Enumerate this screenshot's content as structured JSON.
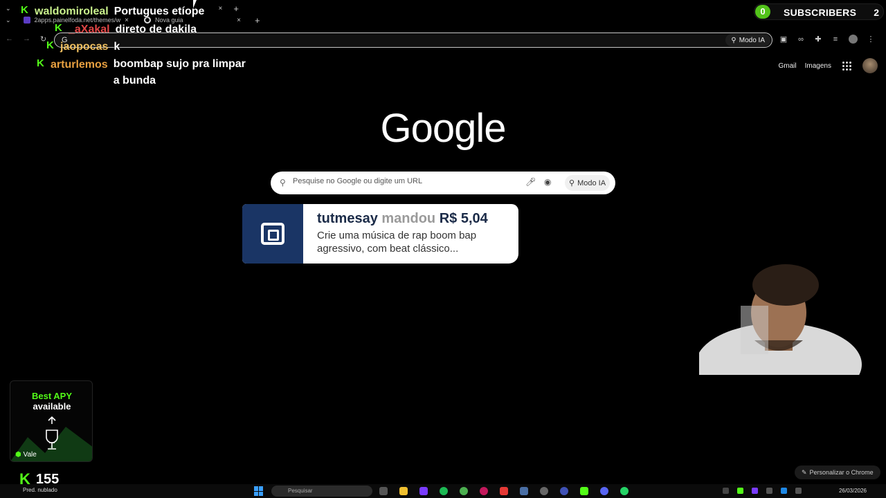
{
  "browser": {
    "tabs_row1": [
      {
        "label": "",
        "close": "×"
      }
    ],
    "tabs_row2": [
      {
        "label": "2apps.painelfoda.net/themes/w",
        "close": "×"
      },
      {
        "label": "Nova guia",
        "close": "×"
      }
    ],
    "new_tab": "+",
    "address_bar": {
      "value": "G",
      "modo_ia_label": "Modo IA"
    }
  },
  "google": {
    "header": {
      "gmail": "Gmail",
      "images": "Imagens"
    },
    "logo": "Google",
    "search": {
      "placeholder": "Pesquise no Google ou digite um URL",
      "modo_ia": "Modo IA"
    },
    "customize": "Personalizar o Chrome"
  },
  "chat": [
    {
      "user": "waldomiroleal",
      "message": "Portugues etíope"
    },
    {
      "user": "_aXakal",
      "message": "direto de dakila"
    },
    {
      "user": "jaopocas",
      "message": "k"
    },
    {
      "user": "arturlemos",
      "message": "boombap sujo pra limpar a bunda"
    }
  ],
  "donation": {
    "user": "tutmesay",
    "verb": "mandou",
    "amount": "R$ 5,04",
    "message": "Crie uma música de rap boom bap agressivo, com beat clássico..."
  },
  "subscribers": {
    "count": "0",
    "label": "SUBSCRIBERS",
    "goal": "2"
  },
  "ad": {
    "line1": "Best APY",
    "line2": "available",
    "brand": "Vale"
  },
  "viewers": {
    "count": "155"
  },
  "taskbar": {
    "weather": "Pred. nublado",
    "search": "Pesquisar",
    "date": "26/03/2026"
  },
  "colors": {
    "kick_green": "#53fc18",
    "donation_blue": "#1a3565",
    "chat_user": "#c9f08c"
  }
}
